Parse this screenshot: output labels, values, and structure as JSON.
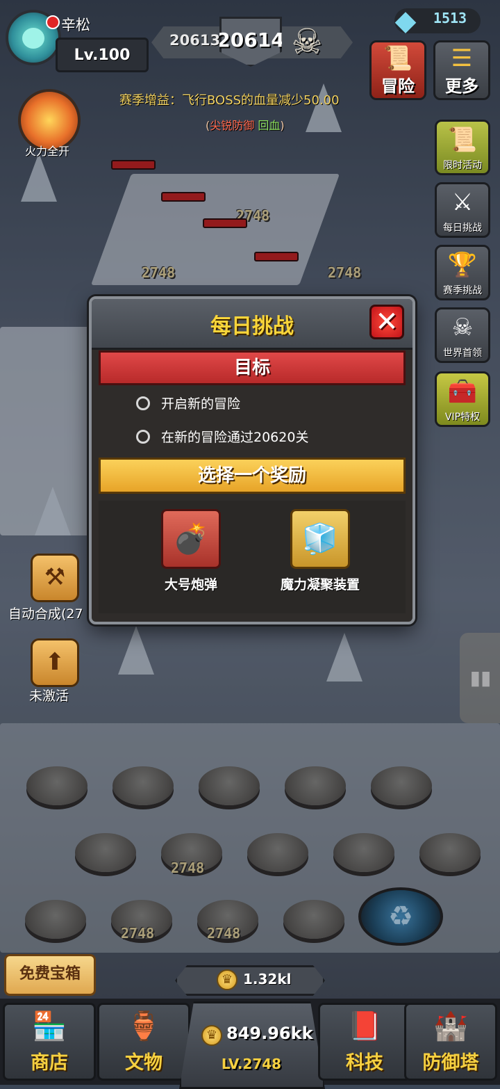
{
  "player": {
    "name": "辛松",
    "level": "Lv.100"
  },
  "stage": {
    "previous": "20613",
    "current": "20614"
  },
  "gems": {
    "count": "1513"
  },
  "top_buttons": {
    "adventure": "冒险",
    "more": "更多"
  },
  "season": {
    "buff": "赛季增益：飞行BOSS的血量减少50.00",
    "traits_open": "(",
    "trait_red": "尖锐防御",
    "trait_green": "回血",
    "traits_close": ")"
  },
  "fire_skill": {
    "label": "火力全开"
  },
  "side_menu": [
    {
      "label": "限时活动",
      "icon": "scroll-icon"
    },
    {
      "label": "每日挑战",
      "icon": "crossed-swords-icon"
    },
    {
      "label": "赛季挑战",
      "icon": "trophy-icon"
    },
    {
      "label": "世界首领",
      "icon": "skull-banner-icon"
    },
    {
      "label": "VIP特权",
      "icon": "treasure-chest-icon"
    }
  ],
  "towers": {
    "level_label": "2748"
  },
  "modal": {
    "title": "每日挑战",
    "objectives_header": "目标",
    "objectives": [
      "开启新的冒险",
      "在新的冒险通过20620关"
    ],
    "reward_header": "选择一个奖励",
    "rewards": [
      {
        "name": "大号炮弹",
        "icon": "bomb-icon"
      },
      {
        "name": "魔力凝聚装置",
        "icon": "magic-cube-icon"
      }
    ]
  },
  "left_actions": {
    "auto_merge": "自动合成(27",
    "inactive": "未激活"
  },
  "bottom": {
    "free_chest": "免费宝箱",
    "coins": "1.32kl",
    "center_coins": "849.96kk",
    "center_level": "LV.2748",
    "nav": [
      "商店",
      "文物",
      "科技",
      "防御塔"
    ]
  },
  "colors": {
    "gold": "#f8d53a",
    "red_banner": "#d03a3a",
    "gold_banner": "#f0b840"
  }
}
